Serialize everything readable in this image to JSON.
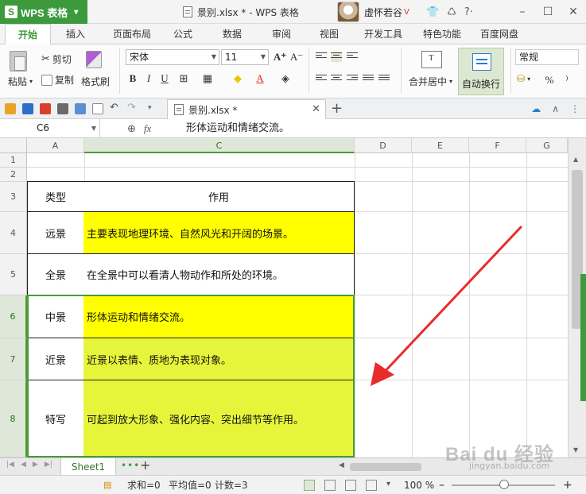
{
  "titlebar": {
    "app_name": "WPS 表格",
    "app_logo": "S",
    "doc_title": "景别.xlsx * - WPS 表格",
    "user_name": "虚怀若谷",
    "vip_badge": "V"
  },
  "menu": {
    "tabs": [
      "开始",
      "插入",
      "页面布局",
      "公式",
      "数据",
      "审阅",
      "视图",
      "开发工具",
      "特色功能",
      "百度网盘"
    ],
    "active": "开始"
  },
  "ribbon": {
    "paste": "粘贴",
    "cut": "剪切",
    "copy": "复制",
    "format_painter": "格式刷",
    "font_name": "宋体",
    "font_size": "11",
    "bold": "B",
    "italic": "I",
    "underline": "U",
    "merge_center": "合并居中",
    "wrap_text": "自动换行",
    "number_format": "常规",
    "percent": "%",
    "comma": "⁾"
  },
  "doc_tab": {
    "label": "景别.xlsx *"
  },
  "formula_bar": {
    "cell_ref": "C6",
    "fx": "fx",
    "content": "形体运动和情绪交流。"
  },
  "grid": {
    "columns": [
      "A",
      "C",
      "D",
      "E",
      "F",
      "G"
    ],
    "selected_column": "C",
    "rows": [
      {
        "num": "1"
      },
      {
        "num": "2"
      },
      {
        "num": "3",
        "a": "类型",
        "c": "作用",
        "fill": "#ffffff"
      },
      {
        "num": "4",
        "a": "远景",
        "c": "主要表现地理环境、自然风光和开阔的场景。",
        "fill": "#ffff00"
      },
      {
        "num": "5",
        "a": "全景",
        "c": "在全景中可以看清人物动作和所处的环境。",
        "fill": "#ffffff"
      },
      {
        "num": "6",
        "a": "中景",
        "c": "形体运动和情绪交流。",
        "fill": "#ffff00"
      },
      {
        "num": "7",
        "a": "近景",
        "c": "近景以表情、质地为表现对象。",
        "fill": "#e6f53a"
      },
      {
        "num": "8",
        "a": "特写",
        "c": "可起到放大形象、强化内容、突出细节等作用。",
        "fill": "#e6f53a"
      }
    ],
    "selected_rows": [
      "6",
      "7",
      "8"
    ]
  },
  "sheets": {
    "tabs": [
      "Sheet1"
    ],
    "more": "•••",
    "add": "+"
  },
  "status": {
    "sum": "求和=0",
    "average": "平均值=0",
    "count": "计数=3",
    "zoom": "100 %"
  },
  "watermark": {
    "main": "Bai du 经验",
    "sub": "jingyan.baidu.com"
  },
  "colors": {
    "accent": "#3c9a3c",
    "selection": "#4a9a3a",
    "yellow": "#ffff00",
    "selected_yellow": "#e6f53a",
    "arrow": "#e82c2c"
  }
}
